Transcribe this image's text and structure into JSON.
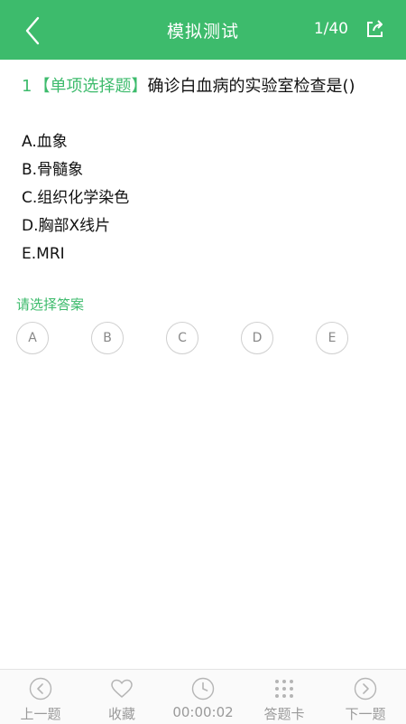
{
  "header": {
    "title": "模拟测试",
    "counter": "1/40",
    "back_icon": "chevron-left-icon",
    "share_icon": "share-icon",
    "background": "#3dbb6c"
  },
  "question": {
    "number": "1",
    "type": "【单项选择题】",
    "text": "确诊白血病的实验室检查是()",
    "options": [
      "A.血象",
      "B.骨髓象",
      "C.组织化学染色",
      "D.胸部X线片",
      "E.MRI"
    ]
  },
  "answer": {
    "hint": "请选择答案",
    "choices": [
      "A",
      "B",
      "C",
      "D",
      "E"
    ]
  },
  "toolbar": {
    "prev_label": "上一题",
    "favorite_label": "收藏",
    "timer": "00:00:02",
    "card_label": "答题卡",
    "next_label": "下一题"
  },
  "colors": {
    "accent": "#3dbb6c",
    "muted": "#9a9a9a"
  }
}
